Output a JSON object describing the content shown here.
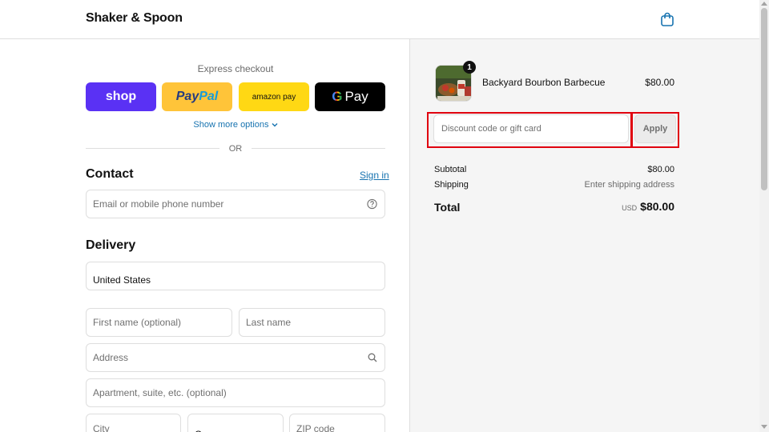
{
  "header": {
    "brand": "Shaker & Spoon",
    "cart_icon": "shopping-bag-icon"
  },
  "express": {
    "title": "Express checkout",
    "buttons": {
      "shop": "shop",
      "paypal_a": "Pay",
      "paypal_b": "Pal",
      "amazon": "amazon pay",
      "gpay_g": "G",
      "gpay_text": "Pay"
    },
    "show_more": "Show more options",
    "or": "OR"
  },
  "contact": {
    "title": "Contact",
    "sign_in": "Sign in",
    "email_placeholder": "Email or mobile phone number"
  },
  "delivery": {
    "title": "Delivery",
    "country": "United States",
    "first_name": "First name (optional)",
    "last_name": "Last name",
    "address": "Address",
    "apartment": "Apartment, suite, etc. (optional)",
    "city": "City",
    "state": "Oregon",
    "zip": "ZIP code"
  },
  "summary": {
    "item": {
      "name": "Backyard Bourbon Barbecue",
      "price": "$80.00",
      "qty": "1"
    },
    "discount_placeholder": "Discount code or gift card",
    "apply": "Apply",
    "subtotal_label": "Subtotal",
    "subtotal_value": "$80.00",
    "shipping_label": "Shipping",
    "shipping_value": "Enter shipping address",
    "total_label": "Total",
    "currency": "USD",
    "total_value": "$80.00"
  },
  "colors": {
    "shop": "#5a31f4",
    "paypal": "#ffc439",
    "amazon": "#ffd814",
    "gpay": "#000000",
    "link": "#1773b0",
    "highlight": "#e0000f"
  }
}
